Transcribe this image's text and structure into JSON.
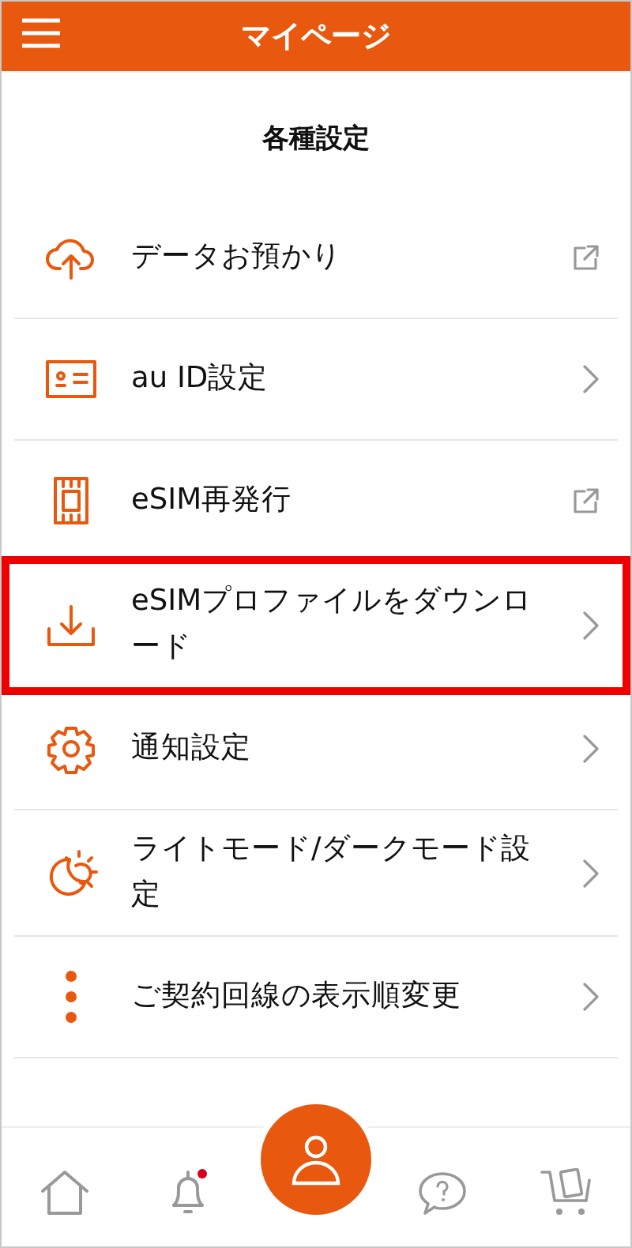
{
  "header": {
    "title": "マイページ"
  },
  "section_title": "各種設定",
  "items": [
    {
      "label": "データお預かり",
      "kind": "external",
      "highlighted": false
    },
    {
      "label": "au ID設定",
      "kind": "chevron",
      "highlighted": false
    },
    {
      "label": "eSIM再発行",
      "kind": "external",
      "highlighted": false
    },
    {
      "label": "eSIMプロファイルをダウンロード",
      "kind": "chevron",
      "highlighted": true
    },
    {
      "label": "通知設定",
      "kind": "chevron",
      "highlighted": false
    },
    {
      "label": "ライトモード/ダークモード設定",
      "kind": "chevron",
      "highlighted": false
    },
    {
      "label": "ご契約回線の表示順変更",
      "kind": "chevron",
      "highlighted": false
    }
  ],
  "tab_bar": [
    {
      "selected": false,
      "unread": false
    },
    {
      "selected": false,
      "unread": true
    },
    {
      "selected": true,
      "unread": false
    },
    {
      "selected": false,
      "unread": false
    },
    {
      "selected": false,
      "unread": false
    }
  ]
}
